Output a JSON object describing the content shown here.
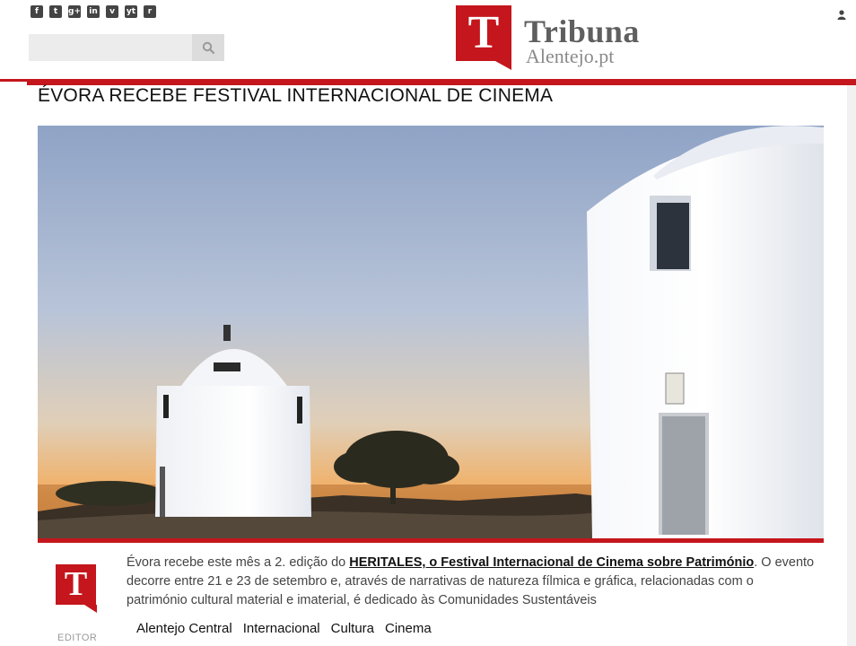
{
  "header": {
    "social_icons": [
      {
        "name": "facebook-icon",
        "glyph": "f"
      },
      {
        "name": "twitter-icon",
        "glyph": "t"
      },
      {
        "name": "google-plus-icon",
        "glyph": "g+"
      },
      {
        "name": "linkedin-icon",
        "glyph": "in"
      },
      {
        "name": "vimeo-icon",
        "glyph": "v"
      },
      {
        "name": "youtube-icon",
        "glyph": "yt"
      },
      {
        "name": "rss-icon",
        "glyph": "r"
      }
    ],
    "search": {
      "placeholder": "",
      "value": ""
    },
    "logo": {
      "letter": "T",
      "line1": "Tribuna",
      "line2": "Alentejo.pt"
    },
    "brand_color": "#c4161c"
  },
  "article": {
    "title": "ÉVORA RECEBE FESTIVAL INTERNACIONAL DE CINEMA",
    "image_description": "",
    "body_before_link": "Évora recebe este mês a 2. edição do ",
    "link_text": "HERITALES, o Festival Internacional de Cinema sobre Património",
    "body_after_link": ". O evento decorre entre 21 e 23 de setembro e, através de narrativas de natureza fílmica e gráfica, relacionadas com o património cultural material e imaterial,  é dedicado às Comunidades Sustentáveis",
    "tags": [
      "Alentejo Central",
      "Internacional",
      "Cultura",
      "Cinema"
    ],
    "author": {
      "logo_letter": "T",
      "label": "EDITOR"
    }
  }
}
